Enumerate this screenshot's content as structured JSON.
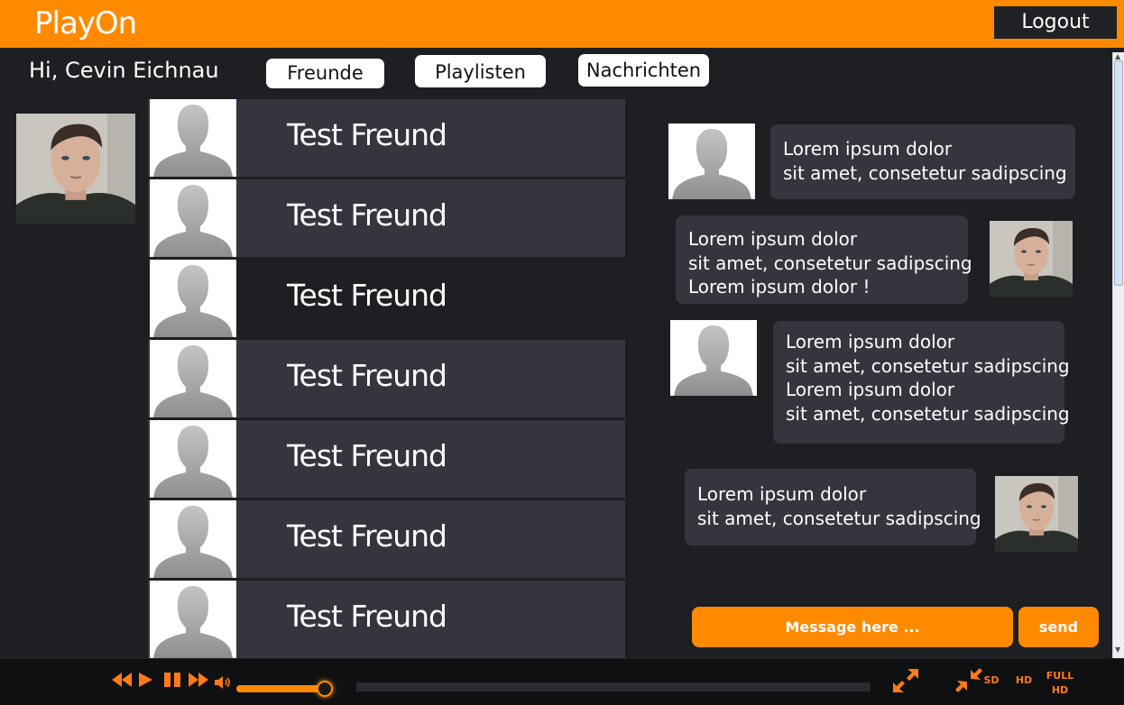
{
  "app": {
    "logo": "PlayOn",
    "logout_label": "Logout"
  },
  "greeting": "Hi, Cevin Eichnau",
  "nav": {
    "freunde": "Freunde",
    "playlisten": "Playlisten",
    "nachrichten": "Nachrichten"
  },
  "friends": [
    {
      "name": "Test Freund"
    },
    {
      "name": "Test Freund"
    },
    {
      "name": "Test Freund"
    },
    {
      "name": "Test Freund"
    },
    {
      "name": "Test Freund"
    },
    {
      "name": "Test Freund"
    },
    {
      "name": "Test Freund"
    }
  ],
  "chat": {
    "messages": [
      {
        "from": "friend",
        "lines": [
          "Lorem ipsum dolor",
          "sit amet, consetetur sadipscing"
        ]
      },
      {
        "from": "user",
        "lines": [
          "Lorem ipsum dolor",
          "sit amet, consetetur sadipscing",
          "Lorem ipsum dolor !"
        ]
      },
      {
        "from": "friend",
        "lines": [
          "Lorem ipsum dolor",
          "sit amet, consetetur sadipscing",
          "Lorem ipsum dolor",
          "sit amet, consetetur sadipscing"
        ]
      },
      {
        "from": "user",
        "lines": [
          "Lorem ipsum dolor",
          "sit amet, consetetur sadipscing"
        ]
      }
    ],
    "input_placeholder": "Message here ...",
    "send_label": "send"
  },
  "player": {
    "volume_level": 0.9,
    "quality": {
      "sd": "SD",
      "hd": "HD",
      "full_line1": "FULL",
      "full_line2": "HD"
    }
  },
  "colors": {
    "accent": "#ff8a00",
    "background": "#1e1f23",
    "panel": "#35363d",
    "player": "#0f1012"
  }
}
